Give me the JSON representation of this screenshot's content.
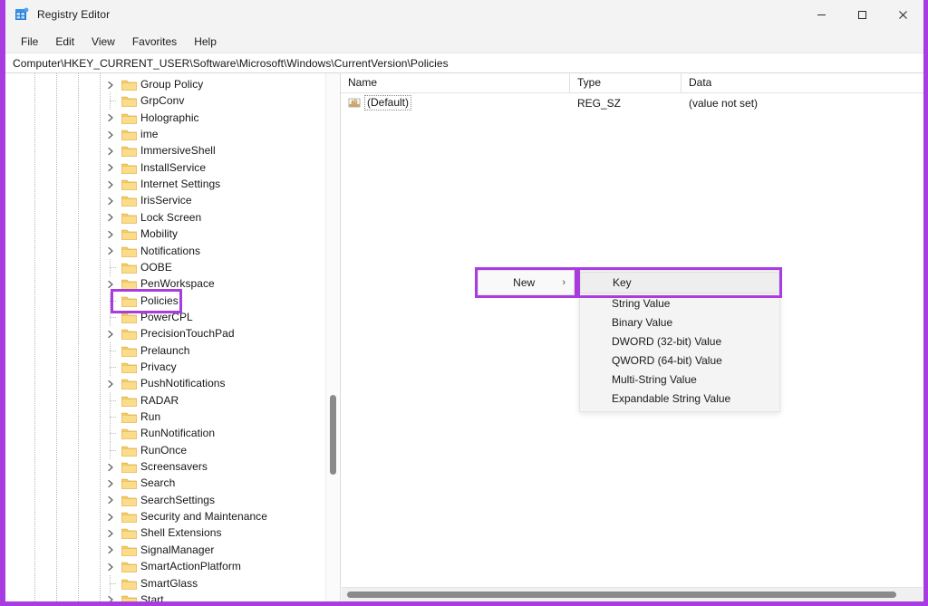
{
  "window": {
    "title": "Registry Editor",
    "icon": "registry-editor-icon",
    "controls": {
      "minimize": "—",
      "maximize": "☐",
      "close": "✕"
    }
  },
  "menubar": {
    "items": [
      {
        "label": "File"
      },
      {
        "label": "Edit"
      },
      {
        "label": "View"
      },
      {
        "label": "Favorites"
      },
      {
        "label": "Help"
      }
    ]
  },
  "address": {
    "path": "Computer\\HKEY_CURRENT_USER\\Software\\Microsoft\\Windows\\CurrentVersion\\Policies"
  },
  "tree": {
    "items": [
      {
        "label": "Group Policy",
        "expandable": true
      },
      {
        "label": "GrpConv",
        "expandable": false
      },
      {
        "label": "Holographic",
        "expandable": true
      },
      {
        "label": "ime",
        "expandable": true
      },
      {
        "label": "ImmersiveShell",
        "expandable": true
      },
      {
        "label": "InstallService",
        "expandable": true
      },
      {
        "label": "Internet Settings",
        "expandable": true
      },
      {
        "label": "IrisService",
        "expandable": true
      },
      {
        "label": "Lock Screen",
        "expandable": true
      },
      {
        "label": "Mobility",
        "expandable": true
      },
      {
        "label": "Notifications",
        "expandable": true
      },
      {
        "label": "OOBE",
        "expandable": false
      },
      {
        "label": "PenWorkspace",
        "expandable": true
      },
      {
        "label": "Policies",
        "expandable": false,
        "highlighted": true
      },
      {
        "label": "PowerCPL",
        "expandable": false
      },
      {
        "label": "PrecisionTouchPad",
        "expandable": true
      },
      {
        "label": "Prelaunch",
        "expandable": false
      },
      {
        "label": "Privacy",
        "expandable": false
      },
      {
        "label": "PushNotifications",
        "expandable": true
      },
      {
        "label": "RADAR",
        "expandable": false
      },
      {
        "label": "Run",
        "expandable": false
      },
      {
        "label": "RunNotification",
        "expandable": false
      },
      {
        "label": "RunOnce",
        "expandable": false
      },
      {
        "label": "Screensavers",
        "expandable": true
      },
      {
        "label": "Search",
        "expandable": true
      },
      {
        "label": "SearchSettings",
        "expandable": true
      },
      {
        "label": "Security and Maintenance",
        "expandable": true
      },
      {
        "label": "Shell Extensions",
        "expandable": true
      },
      {
        "label": "SignalManager",
        "expandable": true
      },
      {
        "label": "SmartActionPlatform",
        "expandable": true
      },
      {
        "label": "SmartGlass",
        "expandable": false
      },
      {
        "label": "Start",
        "expandable": true
      }
    ]
  },
  "list": {
    "columns": [
      "Name",
      "Type",
      "Data"
    ],
    "rows": [
      {
        "name": "(Default)",
        "type": "REG_SZ",
        "data": "(value not set)",
        "icon": "string-value-icon"
      }
    ]
  },
  "context_menu": {
    "parent": {
      "label": "New",
      "arrow": "›"
    },
    "items": [
      {
        "label": "Key",
        "hovered": true
      },
      {
        "label": "String Value",
        "hovered": false
      },
      {
        "label": "Binary Value",
        "hovered": false
      },
      {
        "label": "DWORD (32-bit) Value",
        "hovered": false
      },
      {
        "label": "QWORD (64-bit) Value",
        "hovered": false
      },
      {
        "label": "Multi-String Value",
        "hovered": false
      },
      {
        "label": "Expandable String Value",
        "hovered": false
      }
    ]
  },
  "annotations": {
    "color": "#a93ce0"
  }
}
